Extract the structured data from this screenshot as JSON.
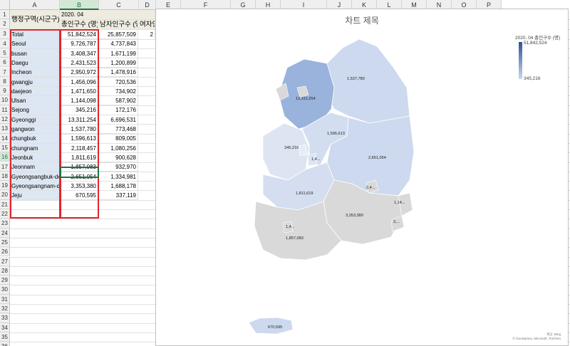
{
  "columns": [
    "A",
    "B",
    "C",
    "D",
    "E",
    "F",
    "G",
    "H",
    "I",
    "J",
    "K",
    "L",
    "M",
    "N",
    "O",
    "P"
  ],
  "selected_column": "B",
  "rows": [
    "1",
    "2",
    "3",
    "4",
    "5",
    "6",
    "7",
    "8",
    "9",
    "10",
    "11",
    "12",
    "13",
    "14",
    "15",
    "16",
    "17",
    "18",
    "19",
    "20",
    "21",
    "22",
    "23",
    "24",
    "25",
    "26",
    "27",
    "28",
    "29",
    "30",
    "31",
    "32",
    "33",
    "34",
    "35",
    "36"
  ],
  "selected_row": "16",
  "header": {
    "a1": "행정구역(시군구)",
    "b1": "2020. 04",
    "b2": "총인구수 (명)",
    "c2": "남자인구수 (명)",
    "d2": "여자인구수 (명)",
    "d3_partial": "2"
  },
  "table": [
    {
      "region": "Total",
      "total": "51,842,524",
      "male": "25,857,509"
    },
    {
      "region": "Seoul",
      "total": "9,726,787",
      "male": "4,737,843"
    },
    {
      "region": "busan",
      "total": "3,408,347",
      "male": "1,671,199"
    },
    {
      "region": "Daegu",
      "total": "2,431,523",
      "male": "1,200,899"
    },
    {
      "region": "Incheon",
      "total": "2,950,972",
      "male": "1,478,916"
    },
    {
      "region": "gwangju",
      "total": "1,456,096",
      "male": "720,536"
    },
    {
      "region": "daejeon",
      "total": "1,471,650",
      "male": "734,902"
    },
    {
      "region": "Ulsan",
      "total": "1,144,098",
      "male": "587,902"
    },
    {
      "region": "Sejong",
      "total": "345,216",
      "male": "172,176"
    },
    {
      "region": "Gyeonggi",
      "total": "13,311,254",
      "male": "6,696,531"
    },
    {
      "region": "gangwon",
      "total": "1,537,780",
      "male": "773,468"
    },
    {
      "region": "chungbuk",
      "total": "1,596,613",
      "male": "809,005"
    },
    {
      "region": "chungnam",
      "total": "2,118,457",
      "male": "1,080,256"
    },
    {
      "region": "Jeonbuk",
      "total": "1,811,619",
      "male": "900,628"
    },
    {
      "region": "Jeonnam",
      "total": "1,857,083",
      "male": "932,970"
    },
    {
      "region": "Gyeongsangbuk-do",
      "total": "2,651,054",
      "male": "1,334,981"
    },
    {
      "region": "Gyeongsangnam-do",
      "total": "3,353,380",
      "male": "1,688,178"
    },
    {
      "region": "Jeju",
      "total": "670,595",
      "male": "337,119"
    }
  ],
  "chart": {
    "title": "차트 제목",
    "legend_title": "2020. 04 총인구수 (명)",
    "legend_max": "51,842,524",
    "legend_min": "345,216",
    "attribution_line1": "제공: Bing",
    "attribution_line2": "© GeoNames, Microsoft, TomTom",
    "colors": {
      "high": "#2e5597",
      "low": "#cad6ec",
      "nodata": "#d9d9d9"
    }
  },
  "map_labels": {
    "gyeonggi": "13,311,254",
    "gangwon": "1,537,780",
    "chungbuk": "1,596,613",
    "sejong": "345,216",
    "daejeon": "1,4...",
    "gyeongbuk": "2,651,054",
    "daegu": "2,4...",
    "jeonbuk": "1,811,619",
    "gyeongnam": "3,353,380",
    "ulsan": "1,14...",
    "busan": "3,...",
    "gwangju": "1,4...",
    "jeonnam": "1,857,083",
    "jeju": "670,595"
  }
}
